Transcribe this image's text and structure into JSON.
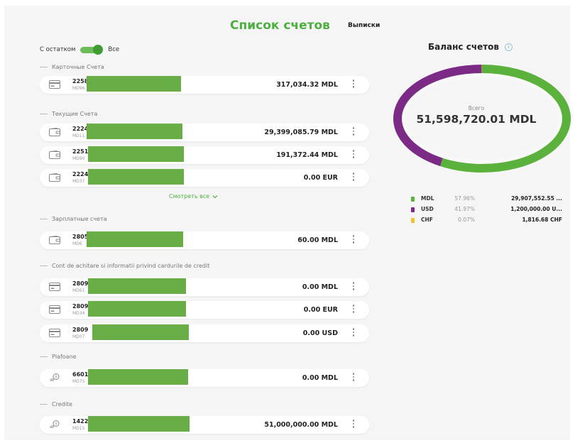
{
  "tabs": {
    "accounts_list": "Список счетов",
    "statements": "Выписки"
  },
  "filter": {
    "left_label": "С остатком",
    "right_label": "Все"
  },
  "sections": [
    {
      "title": "Карточные Счета",
      "accounts": [
        {
          "number": "2258",
          "sub": "MD96",
          "amount": "317,034.32 MDL",
          "icon": "card-icon"
        }
      ]
    },
    {
      "title": "Текущие Счета",
      "accounts": [
        {
          "number": "2224",
          "sub": "MD11",
          "amount": "29,399,085.79 MDL",
          "icon": "wallet-icon"
        },
        {
          "number": "2251",
          "sub": "MD90",
          "amount": "191,372.44 MDL",
          "icon": "wallet-icon"
        },
        {
          "number": "2224",
          "sub": "MD37",
          "amount": "0.00 EUR",
          "icon": "wallet-icon"
        }
      ],
      "see_all": "Смотреть все"
    },
    {
      "title": "Зарплатные счета",
      "accounts": [
        {
          "number": "2805",
          "sub": "MD6",
          "amount": "60.00 MDL",
          "icon": "wallet-icon"
        }
      ]
    },
    {
      "title": "Cont de achitare si informatii privind cardurile de credit",
      "accounts": [
        {
          "number": "2809",
          "sub": "MD61",
          "amount": "0.00 MDL",
          "icon": "card-icon"
        },
        {
          "number": "2809",
          "sub": "MD34",
          "amount": "0.00 EUR",
          "icon": "card-icon"
        },
        {
          "number": "2809",
          "sub": "MD07",
          "amount": "0.00 USD",
          "icon": "card-icon"
        }
      ]
    },
    {
      "title": "Plafoane",
      "accounts": [
        {
          "number": "6601",
          "sub": "MD75",
          "amount": "0.00 MDL",
          "icon": "coins-icon"
        }
      ]
    },
    {
      "title": "Credite",
      "accounts": [
        {
          "number": "1422",
          "sub": "MD15",
          "amount": "51,000,000.00 MDL",
          "icon": "coins-icon"
        }
      ]
    }
  ],
  "balance": {
    "title": "Баланс счетов",
    "total_label": "Всего",
    "total": "51,598,720.01 MDL",
    "legend": [
      {
        "currency": "MDL",
        "percent": "57.96%",
        "value": "29,907,552.55 ...",
        "fraction": 0.5796,
        "color": "#5ab13b"
      },
      {
        "currency": "USD",
        "percent": "41.97%",
        "value": "1,200,000.00 U...",
        "fraction": 0.4197,
        "color": "#7b2a86"
      },
      {
        "currency": "CHF",
        "percent": "0.07%",
        "value": "1,816.68 CHF",
        "fraction": 0.0007,
        "color": "#f4c02b"
      }
    ]
  },
  "colors": {
    "accent": "#4caf3f",
    "mask": "#68ad46"
  }
}
